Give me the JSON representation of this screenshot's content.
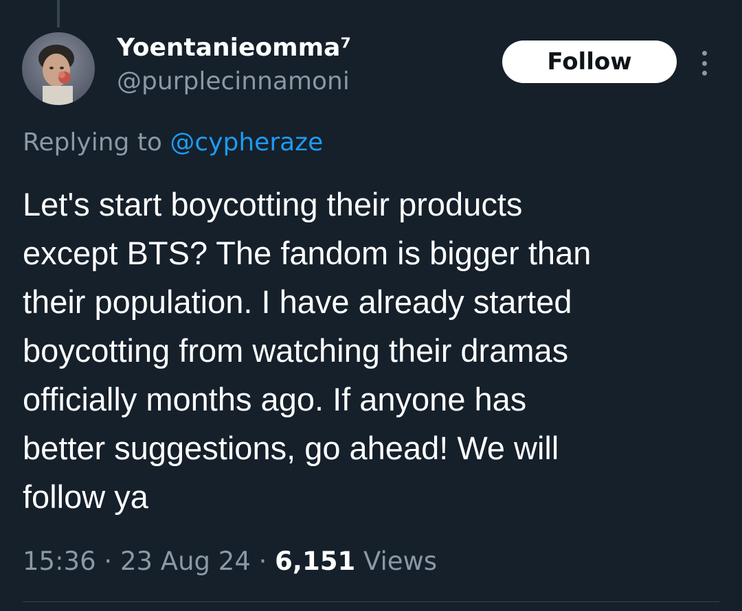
{
  "author": {
    "display_name": "Yoentanieomma⁷",
    "handle": "@purplecinnamoni"
  },
  "actions": {
    "follow_label": "Follow",
    "more_icon": "more-vertical-icon"
  },
  "reply": {
    "prefix": "Replying to ",
    "mention": "@cypheraze"
  },
  "tweet": {
    "lines": [
      "Let's start boycotting their products",
      "except BTS? The fandom is bigger than",
      "their population. I have already started",
      "boycotting from watching their dramas",
      "officially months ago. If anyone has",
      "better suggestions, go ahead! We will",
      "follow ya"
    ]
  },
  "meta": {
    "time": "15:36",
    "separator": " · ",
    "date": "23 Aug 24",
    "views_count": "6,151",
    "views_label": " Views"
  },
  "colors": {
    "background": "#15202b",
    "text": "#ffffff",
    "secondary_text": "#8b98a5",
    "link": "#1d9bf0",
    "follow_bg": "#ffffff"
  }
}
